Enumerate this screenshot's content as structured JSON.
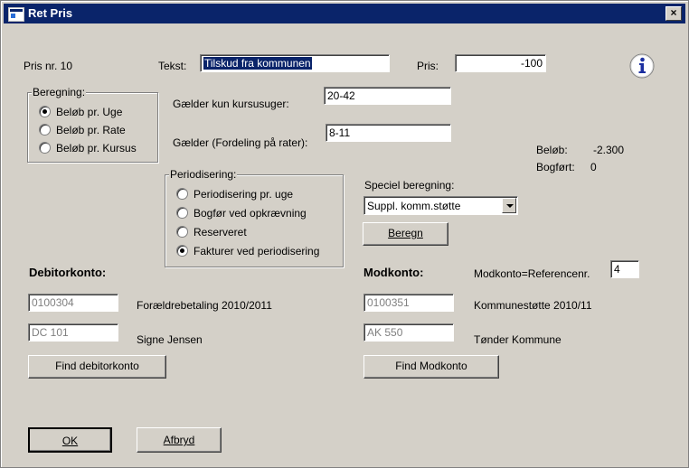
{
  "window": {
    "title": "Ret Pris",
    "close_label": "×"
  },
  "header": {
    "pris_nr_label": "Pris nr. 10",
    "tekst_label": "Tekst:",
    "tekst_value": "Tilskud fra kommunen",
    "pris_label": "Pris:",
    "pris_value": "-100"
  },
  "beregning": {
    "legend": "Beregning:",
    "options": [
      "Beløb pr. Uge",
      "Beløb pr. Rate",
      "Beløb pr. Kursus"
    ],
    "selected": 0
  },
  "gaelder": {
    "kursusuger_label": "Gælder kun kursusuger:",
    "kursusuger_value": "20-42",
    "rater_label": "Gælder (Fordeling på rater):",
    "rater_value": "8-11"
  },
  "summary": {
    "beloeb_label": "Beløb:",
    "beloeb_value": "-2.300",
    "bogfoert_label": "Bogført:",
    "bogfoert_value": "0"
  },
  "periodisering": {
    "legend": "Periodisering:",
    "options": [
      "Periodisering pr. uge",
      "Bogfør ved opkrævning",
      "Reserveret",
      "Fakturer ved periodisering"
    ],
    "selected": 3
  },
  "speciel": {
    "label": "Speciel beregning:",
    "value": "Suppl. komm.støtte",
    "beregn_button": "Beregn"
  },
  "debitor": {
    "heading": "Debitorkonto:",
    "konto_value": "0100304",
    "konto_text": "Forældrebetaling 2010/2011",
    "debitor_value": "DC  101",
    "debitor_text": "Signe Jensen",
    "find_button": "Find debitorkonto"
  },
  "modkonto": {
    "heading": "Modkonto:",
    "ref_label": "Modkonto=Referencenr.",
    "ref_value": "4",
    "konto_value": "0100351",
    "konto_text": "Kommunestøtte 2010/11",
    "second_value": "AK  550",
    "second_text": "Tønder Kommune",
    "find_button": "Find Modkonto"
  },
  "footer": {
    "ok_button": "OK",
    "cancel_button": "Afbryd"
  },
  "colors": {
    "titlebar": "#0a246a",
    "face": "#d4d0c8",
    "info_blue": "#1c2fa0"
  }
}
